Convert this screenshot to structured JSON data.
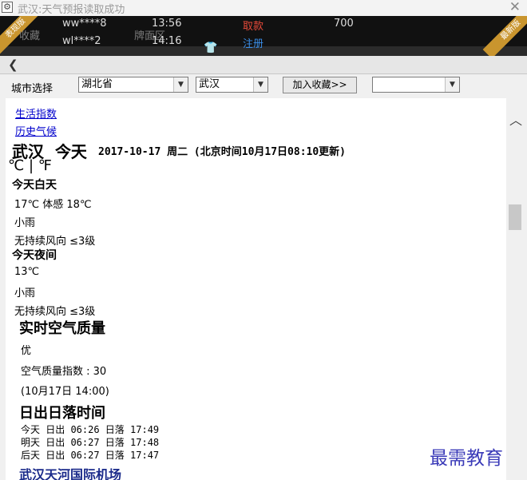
{
  "window": {
    "title": "武汉:天气预报读取成功",
    "app_icon": "gear-icon",
    "close": "✕"
  },
  "ticker": {
    "corner_left": "表现版",
    "corner_right": "最新版",
    "users": [
      "ww****8",
      "wl****2"
    ],
    "times": [
      "13:56",
      "14:16"
    ],
    "ghost_left": "收藏",
    "ghost_mid": "牌面区",
    "links": [
      "取款",
      "注册"
    ],
    "amount": "700"
  },
  "nav": {
    "back": "❮"
  },
  "selector": {
    "label": "城市选择",
    "province": "湖北省",
    "city": "武汉",
    "add_favorite": "加入收藏>>",
    "favorite_value": ""
  },
  "content": {
    "link_life": "生活指数",
    "link_history": "历史气候",
    "city": "武汉",
    "today": "今天",
    "date_line": "2017-10-17 周二 (北京时间10月17日08:10更新)",
    "unit_c": "℃",
    "unit_sep": "|",
    "unit_f": "℉",
    "day": {
      "heading": "今天白天",
      "temp": "17℃ 体感 18℃",
      "weather": "小雨",
      "wind": "无持续风向 ≤3级"
    },
    "night": {
      "heading": "今天夜间",
      "temp": "13℃",
      "weather": "小雨",
      "wind": "无持续风向 ≤3级"
    },
    "air": {
      "heading": "实时空气质量",
      "level": "优",
      "index": "空气质量指数 : 30",
      "time": "(10月17日 14:00)"
    },
    "sun": {
      "heading": "日出日落时间",
      "rows": [
        "今天 日出 06:26 日落 17:49",
        "明天 日出 06:27 日落 17:48",
        "后天 日出 06:27 日落 17:47"
      ]
    },
    "airport": "武汉天河国际机场"
  },
  "watermark": "最需教育"
}
